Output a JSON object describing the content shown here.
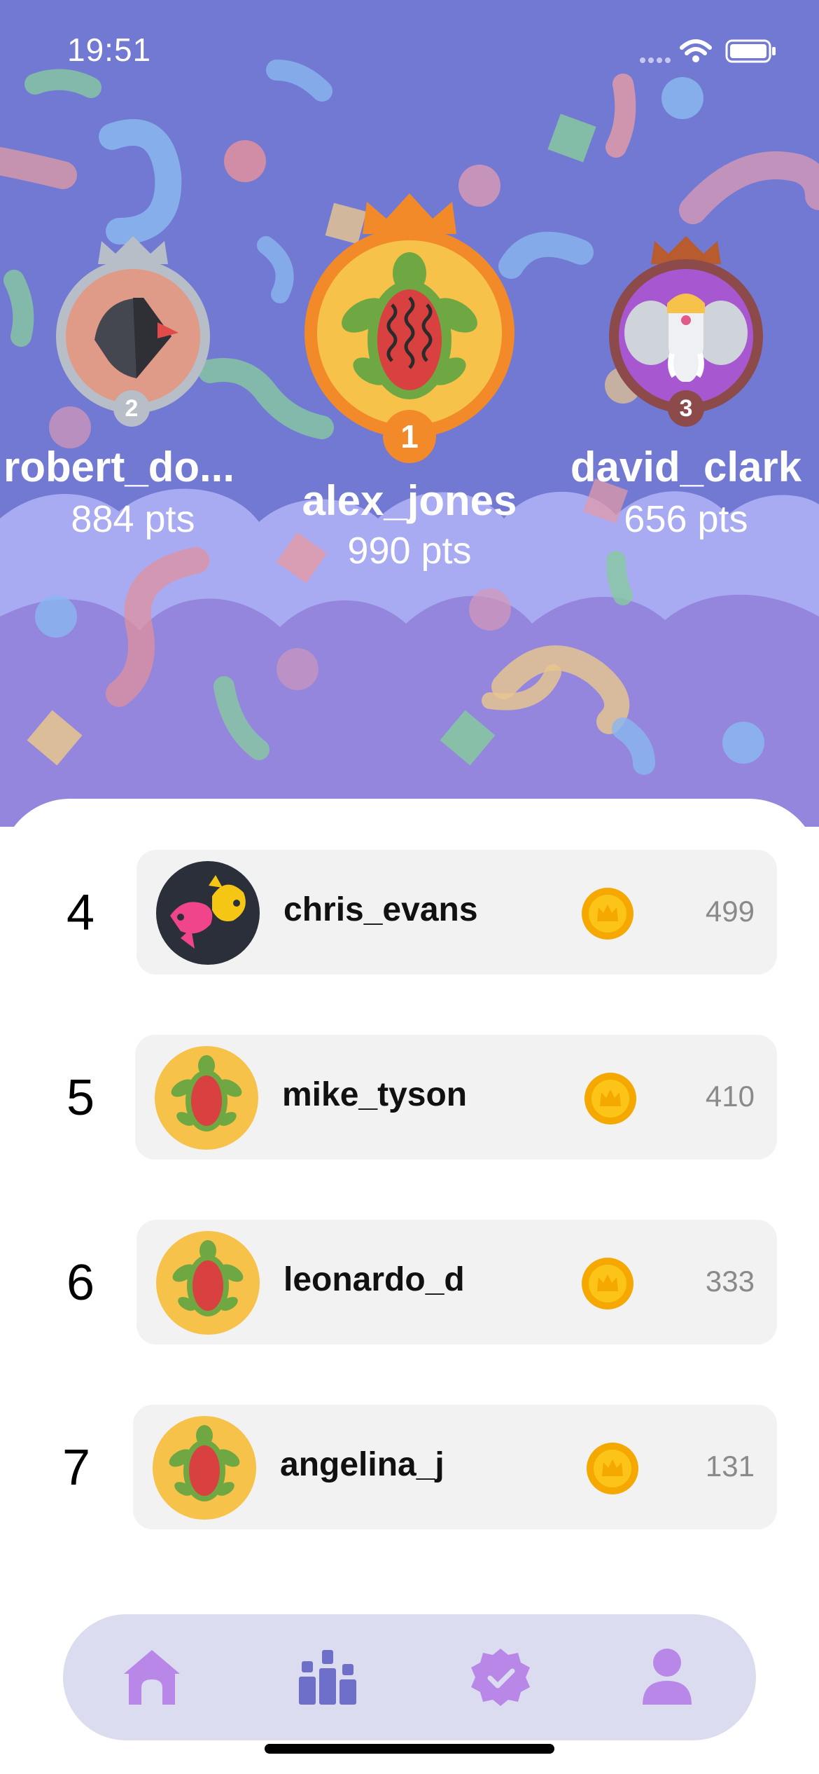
{
  "status": {
    "time": "19:51"
  },
  "podium": {
    "first": {
      "rank": "1",
      "name": "alex_jones",
      "points": "990 pts",
      "avatar": "turtle-avatar-icon"
    },
    "second": {
      "rank": "2",
      "name": "robert_do...",
      "points": "884 pts",
      "avatar": "bird-avatar-icon"
    },
    "third": {
      "rank": "3",
      "name": "david_clark",
      "points": "656 pts",
      "avatar": "elephant-avatar-icon"
    }
  },
  "leaderboard": [
    {
      "rank": "4",
      "name": "chris_evans",
      "score": "499",
      "avatar": "fish-avatar-icon"
    },
    {
      "rank": "5",
      "name": "mike_tyson",
      "score": "410",
      "avatar": "turtle-avatar-icon"
    },
    {
      "rank": "6",
      "name": "leonardo_d",
      "score": "333",
      "avatar": "turtle-avatar-icon"
    },
    {
      "rank": "7",
      "name": "angelina_j",
      "score": "131",
      "avatar": "turtle-avatar-icon"
    }
  ],
  "tabs": [
    {
      "name": "home",
      "icon": "home-icon",
      "active": true
    },
    {
      "name": "leaderboard",
      "icon": "podium-icon",
      "active": false
    },
    {
      "name": "badges",
      "icon": "badge-check-icon",
      "active": false
    },
    {
      "name": "profile",
      "icon": "person-icon",
      "active": false
    }
  ],
  "colors": {
    "hero_bg": "#7279d2",
    "cloud_light": "#a9abf2",
    "cloud_purple": "#9486dc",
    "gold": "#f39b2a",
    "silver": "#b7bec8",
    "bronze": "#8d4a4a",
    "coin": "#f5a800",
    "tab_active": "#b987e8",
    "tab_inactive": "#6d6fc9"
  }
}
